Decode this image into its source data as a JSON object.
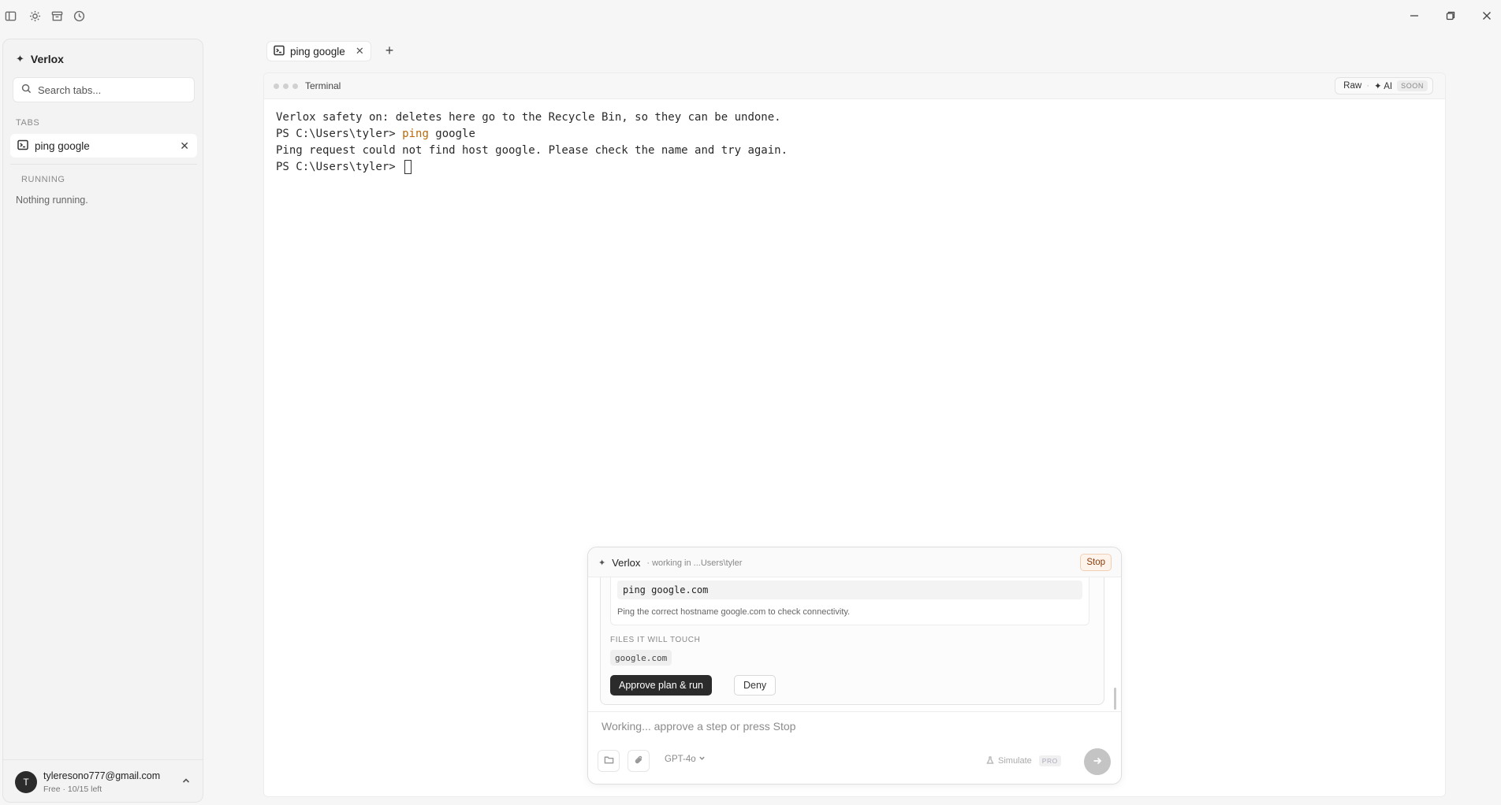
{
  "titlebar": {
    "icons": [
      "sidebar-toggle-icon",
      "sun-icon",
      "archive-icon",
      "history-icon"
    ],
    "window_controls": [
      "minimize-icon",
      "restore-icon",
      "close-icon"
    ]
  },
  "sidebar": {
    "brand": "Verlox",
    "search_placeholder": "Search tabs...",
    "tabs_label": "TABS",
    "tabs": [
      {
        "label": "ping google",
        "icon": "terminal-icon"
      }
    ],
    "running_label": "RUNNING",
    "running_empty": "Nothing running.",
    "user": {
      "initial": "T",
      "email": "tyleresono777@gmail.com",
      "plan": "Free · 10/15 left"
    }
  },
  "tabbar": {
    "active_tab": "ping google"
  },
  "terminal": {
    "title": "Terminal",
    "mode_raw": "Raw",
    "mode_ai": "✦ AI",
    "soon_badge": "SOON",
    "lines": [
      {
        "prefix": "Verlox safety on: deletes here go to the Recycle Bin, so they can be undone.",
        "cmd": "",
        "rest": ""
      },
      {
        "prefix": "PS C:\\Users\\tyler> ",
        "cmd": "ping",
        "rest": " google"
      },
      {
        "prefix": "Ping request could not find host google. Please check the name and try again.",
        "cmd": "",
        "rest": ""
      },
      {
        "prefix": "PS C:\\Users\\tyler> ",
        "cmd": "",
        "rest": ""
      }
    ]
  },
  "agent": {
    "name": "Verlox",
    "status": "· working in ...Users\\tyler",
    "stop_label": "Stop",
    "step_command": "ping google.com",
    "step_description": "Ping the correct hostname google.com to check connectivity.",
    "files_label": "FILES IT WILL TOUCH",
    "files": [
      "google.com"
    ],
    "approve_label": "Approve plan & run",
    "deny_label": "Deny",
    "input_placeholder": "Working... approve a step or press Stop",
    "model": "GPT-4o",
    "simulate_label": "Simulate",
    "pro_badge": "PRO"
  }
}
